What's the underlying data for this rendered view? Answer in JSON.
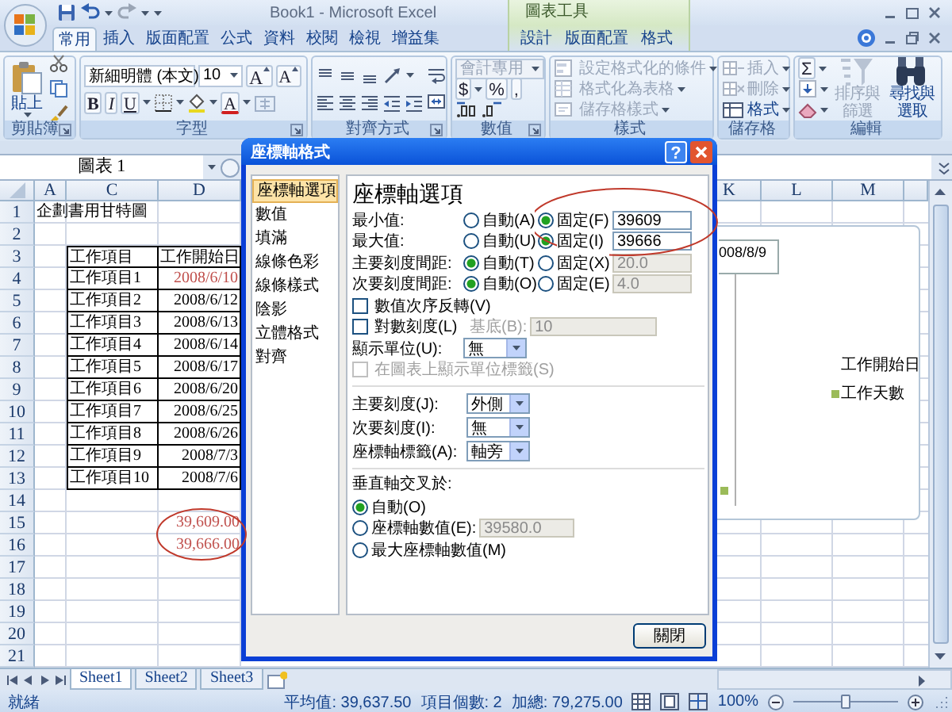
{
  "window": {
    "title": "Book1 - Microsoft Excel"
  },
  "tabs": [
    {
      "label": "常用",
      "selected": true
    },
    {
      "label": "插入",
      "selected": false
    },
    {
      "label": "版面配置",
      "selected": false
    },
    {
      "label": "公式",
      "selected": false
    },
    {
      "label": "資料",
      "selected": false
    },
    {
      "label": "校閱",
      "selected": false
    },
    {
      "label": "檢視",
      "selected": false
    },
    {
      "label": "增益集",
      "selected": false
    }
  ],
  "context_tabs": {
    "title": "圖表工具",
    "tabs": [
      {
        "label": "設計",
        "selected": false
      },
      {
        "label": "版面配置",
        "selected": false
      },
      {
        "label": "格式",
        "selected": false
      }
    ]
  },
  "ribbon": {
    "clipboard": {
      "label": "剪貼簿",
      "paste": "貼上"
    },
    "font": {
      "label": "字型",
      "face": "新細明體 (本文)",
      "size": "10",
      "grow": "A",
      "shrink": "A",
      "bold": "B",
      "italic": "I",
      "underline": "U",
      "font_color": "A"
    },
    "alignment": {
      "label": "對齊方式"
    },
    "number": {
      "label": "數值",
      "format": {
        "value": "會計專用",
        "disabled": true
      },
      "currency": "$",
      "percent": "%",
      "comma": ","
    },
    "styles": {
      "label": "樣式",
      "items": [
        {
          "label": "設定格式化的條件",
          "disabled": true
        },
        {
          "label": "格式化為表格",
          "disabled": true
        },
        {
          "label": "儲存格樣式",
          "disabled": true
        }
      ]
    },
    "cells": {
      "label": "儲存格",
      "items": [
        {
          "label": "插入",
          "disabled": true
        },
        {
          "label": "刪除",
          "disabled": true
        },
        {
          "label": "格式",
          "disabled": false
        }
      ]
    },
    "editing": {
      "label": "編輯",
      "autosum": "Σ",
      "sort": {
        "label": "排序與篩選",
        "disabled": true
      },
      "find": {
        "label": "尋找與選取",
        "disabled": false
      }
    }
  },
  "sheet": {
    "name_box": "圖表 1",
    "columns": [
      {
        "label": "A"
      },
      {
        "label": "C"
      },
      {
        "label": "D"
      },
      {
        "label": "K"
      },
      {
        "label": "L"
      },
      {
        "label": "M"
      }
    ],
    "rows": [
      {
        "number": "1",
        "kind": "title",
        "a": "企劃書用甘特圖"
      },
      {
        "number": "2",
        "kind": "blank"
      },
      {
        "number": "3",
        "kind": "header",
        "c": "工作項目",
        "d": "工作開始日",
        "marked": false
      },
      {
        "number": "4",
        "kind": "item",
        "c": "工作項目1",
        "d": "2008/6/10",
        "marked": true
      },
      {
        "number": "5",
        "kind": "item",
        "c": "工作項目2",
        "d": "2008/6/12",
        "marked": false
      },
      {
        "number": "6",
        "kind": "item",
        "c": "工作項目3",
        "d": "2008/6/13",
        "marked": false
      },
      {
        "number": "7",
        "kind": "item",
        "c": "工作項目4",
        "d": "2008/6/14",
        "marked": false
      },
      {
        "number": "8",
        "kind": "item",
        "c": "工作項目5",
        "d": "2008/6/17",
        "marked": false
      },
      {
        "number": "9",
        "kind": "item",
        "c": "工作項目6",
        "d": "2008/6/20",
        "marked": false
      },
      {
        "number": "10",
        "kind": "item",
        "c": "工作項目7",
        "d": "2008/6/25",
        "marked": false
      },
      {
        "number": "11",
        "kind": "item",
        "c": "工作項目8",
        "d": "2008/6/26",
        "marked": false
      },
      {
        "number": "12",
        "kind": "item",
        "c": "工作項目9",
        "d": "2008/7/3",
        "marked": false
      },
      {
        "number": "13",
        "kind": "item",
        "c": "工作項目10",
        "d": "2008/7/6",
        "marked": false
      },
      {
        "number": "14",
        "kind": "blank"
      },
      {
        "number": "15",
        "kind": "value",
        "d": "39,609.00",
        "marked": true
      },
      {
        "number": "16",
        "kind": "value",
        "d": "39,666.00",
        "marked": true
      },
      {
        "number": "17",
        "kind": "blank"
      },
      {
        "number": "18",
        "kind": "blank"
      },
      {
        "number": "19",
        "kind": "blank"
      },
      {
        "number": "20",
        "kind": "blank"
      },
      {
        "number": "21",
        "kind": "blank"
      }
    ],
    "sheet_tabs": [
      {
        "label": "Sheet1",
        "selected": true
      },
      {
        "label": "Sheet2",
        "selected": false
      },
      {
        "label": "Sheet3",
        "selected": false
      }
    ]
  },
  "chart": {
    "axis_label": "008/8/9",
    "legend": [
      {
        "label": "工作開始日",
        "swatch": false
      },
      {
        "label": "工作天數",
        "swatch": true
      }
    ]
  },
  "dialog": {
    "title": "座標軸格式",
    "help": "?",
    "nav": [
      {
        "label": "座標軸選項",
        "selected": true
      },
      {
        "label": "數值",
        "selected": false
      },
      {
        "label": "填滿",
        "selected": false
      },
      {
        "label": "線條色彩",
        "selected": false
      },
      {
        "label": "線條樣式",
        "selected": false
      },
      {
        "label": "陰影",
        "selected": false
      },
      {
        "label": "立體格式",
        "selected": false
      },
      {
        "label": "對齊",
        "selected": false
      }
    ],
    "heading": "座標軸選項",
    "scale": [
      {
        "label": "最小值:",
        "auto": "自動(A)",
        "auto_selected": false,
        "fixed": "固定(F)",
        "fixed_selected": true,
        "value": "39609"
      },
      {
        "label": "最大值:",
        "auto": "自動(U)",
        "auto_selected": false,
        "fixed": "固定(I)",
        "fixed_selected": true,
        "value": "39666"
      },
      {
        "label": "主要刻度間距:",
        "auto": "自動(T)",
        "auto_selected": true,
        "fixed": "固定(X)",
        "fixed_selected": false,
        "value": "20.0"
      },
      {
        "label": "次要刻度間距:",
        "auto": "自動(O)",
        "auto_selected": true,
        "fixed": "固定(E)",
        "fixed_selected": false,
        "value": "4.0"
      }
    ],
    "reverse": {
      "label": "數值次序反轉(V)",
      "checked": false
    },
    "log": {
      "label": "對數刻度(L)",
      "checked": false,
      "base_label": "基底(B):",
      "base_value": "10"
    },
    "units": {
      "label": "顯示單位(U):",
      "value": "無"
    },
    "unit_label": {
      "label": "在圖表上顯示單位標籤(S)",
      "checked": false,
      "disabled": true
    },
    "ticks": [
      {
        "label": "主要刻度(J):",
        "value": "外側"
      },
      {
        "label": "次要刻度(I):",
        "value": "無"
      },
      {
        "label": "座標軸標籤(A):",
        "value": "軸旁"
      }
    ],
    "cross": {
      "title": "垂直軸交叉於:",
      "options": [
        {
          "label": "自動(O)",
          "selected": true
        },
        {
          "label": "座標軸數值(E):",
          "selected": false,
          "value": "39580.0"
        },
        {
          "label": "最大座標軸數值(M)",
          "selected": false
        }
      ]
    },
    "close": "關閉"
  },
  "status": {
    "ready": "就緒",
    "average": "平均值: 39,637.50",
    "count": "項目個數: 2",
    "sum": "加總: 79,275.00",
    "zoom": {
      "label": "100%",
      "level": 0.5
    }
  }
}
